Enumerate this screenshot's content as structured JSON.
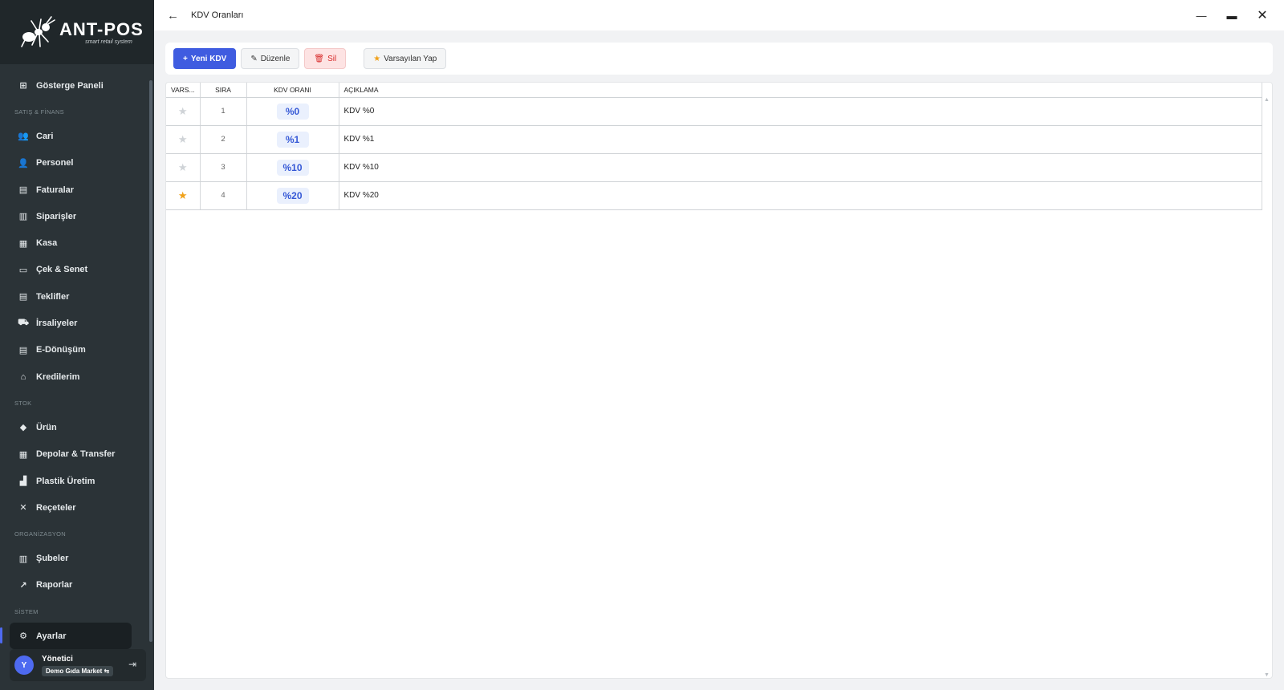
{
  "app": {
    "brand": "ANT-POS",
    "tagline": "smart retail system"
  },
  "sidebar": {
    "sections": [
      {
        "title": "",
        "items": [
          {
            "label": "Gösterge Paneli",
            "icon": "dashboard-icon"
          }
        ]
      },
      {
        "title": "SATIŞ & FİNANS",
        "items": [
          {
            "label": "Cari",
            "icon": "users-icon"
          },
          {
            "label": "Personel",
            "icon": "user-tie-icon"
          },
          {
            "label": "Faturalar",
            "icon": "invoice-icon"
          },
          {
            "label": "Siparişler",
            "icon": "clipboard-icon"
          },
          {
            "label": "Kasa",
            "icon": "cash-register-icon"
          },
          {
            "label": "Çek & Senet",
            "icon": "cheque-icon"
          },
          {
            "label": "Teklifler",
            "icon": "document-icon"
          },
          {
            "label": "İrsaliyeler",
            "icon": "truck-icon"
          },
          {
            "label": "E-Dönüşüm",
            "icon": "e-document-icon"
          },
          {
            "label": "Kredilerim",
            "icon": "bank-icon"
          }
        ]
      },
      {
        "title": "STOK",
        "items": [
          {
            "label": "Ürün",
            "icon": "tag-icon"
          },
          {
            "label": "Depolar & Transfer",
            "icon": "warehouse-icon"
          },
          {
            "label": "Plastik Üretim",
            "icon": "factory-icon"
          },
          {
            "label": "Reçeteler",
            "icon": "utensils-icon"
          }
        ]
      },
      {
        "title": "ORGANİZASYON",
        "items": [
          {
            "label": "Şubeler",
            "icon": "building-icon"
          },
          {
            "label": "Raporlar",
            "icon": "chart-line-icon"
          }
        ]
      },
      {
        "title": "SİSTEM",
        "items": [
          {
            "label": "Ayarlar",
            "icon": "gears-icon",
            "active": true
          }
        ]
      }
    ]
  },
  "user": {
    "initial": "Y",
    "name": "Yönetici",
    "company": "Demo Gıda Market"
  },
  "titlebar": {
    "title": "KDV Oranları"
  },
  "toolbar": {
    "new_label": "Yeni KDV",
    "edit_label": "Düzenle",
    "delete_label": "Sil",
    "default_label": "Varsayılan Yap"
  },
  "table": {
    "columns": [
      "VARS...",
      "SIRA",
      "KDV ORANI",
      "AÇIKLAMA"
    ],
    "rows": [
      {
        "is_default": false,
        "order": "1",
        "rate": "%0",
        "description": "KDV %0"
      },
      {
        "is_default": false,
        "order": "2",
        "rate": "%1",
        "description": "KDV %1"
      },
      {
        "is_default": false,
        "order": "3",
        "rate": "%10",
        "description": "KDV %10"
      },
      {
        "is_default": true,
        "order": "4",
        "rate": "%20",
        "description": "KDV %20"
      }
    ]
  },
  "colors": {
    "sidebar_bg": "#2b3337",
    "primary": "#3f5ce0",
    "danger": "#d82c2c",
    "default_star": "#f0a11a",
    "badge_text": "#3558d6"
  }
}
